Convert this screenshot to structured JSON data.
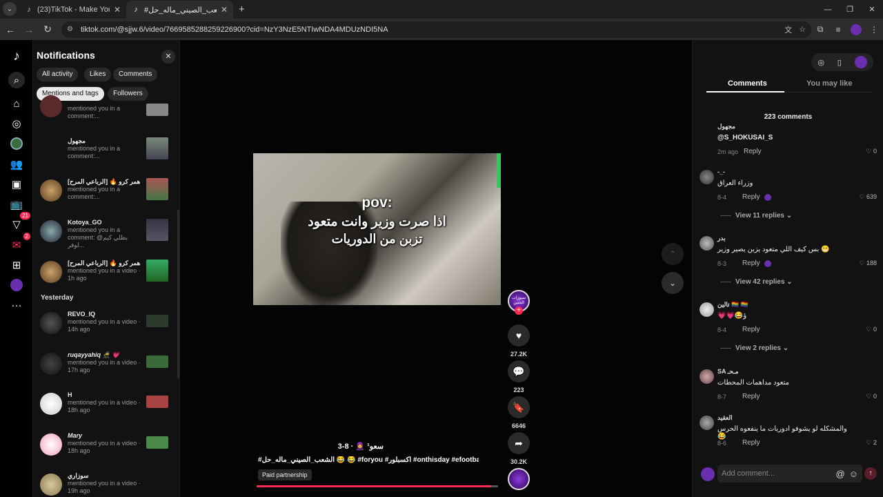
{
  "browser": {
    "tabs": [
      {
        "title": "(23)TikTok - Make Your Day",
        "icon": "tiktok-icon"
      },
      {
        "title": "#الشعب_الصيني_ماله_حل 😂 ...",
        "icon": "tiktok-icon"
      }
    ],
    "url": "tiktok.com/@sjjw.6/video/7669585288259226900?cid=NzY3NzE5NTIwNDA4MDUzNDI5NA"
  },
  "rail": {
    "messages_badge": "2",
    "activity_badge": "21"
  },
  "notifications": {
    "title": "Notifications",
    "chips": [
      "All activity",
      "Likes",
      "Comments",
      "Mentions and tags",
      "Followers"
    ],
    "active_chip": "Mentions and tags",
    "section_yesterday": "Yesterday",
    "items": [
      {
        "name": "",
        "text": "mentioned you in a comment:..."
      },
      {
        "name": "مجهول",
        "text": "mentioned you in a comment:..."
      },
      {
        "name": "[الرباعي المرح] 🔥 همر كرو ...",
        "text": "mentioned you in a comment:..."
      },
      {
        "name": "Kotoya_GO",
        "text": "mentioned you in a comment: @بطلي كيم لوفر..."
      },
      {
        "name": "[الرباعي المرح] 🔥 همر كرو ...",
        "text": "mentioned you in a video · 1h ago"
      },
      {
        "name": "REVO_IQ",
        "text": "mentioned you in a video · 14h ago"
      },
      {
        "name": "ruqayyahiq 🥷 💗",
        "text": "mentioned you in a video · 17h ago"
      },
      {
        "name": "H",
        "text": "mentioned you in a video · 18h ago"
      },
      {
        "name": "Mary",
        "text": "mentioned you in a video · 18h ago"
      },
      {
        "name": "سوزاري",
        "text": "mentioned you in a video · 19h ago"
      }
    ]
  },
  "video": {
    "overlay_line1": "pov:",
    "overlay_line2": "اذا صرت وزير وانت متعود",
    "overlay_line3": "تزبن من الدوريات",
    "author": "سعو¹ 🧕 · 8-3",
    "caption": "#الشعب_الصيني_ماله_حل 😂 😂 #foryou #اكسبلور #onthisday #efootball",
    "paid_label": "Paid partnership",
    "progress": 0.97,
    "creator_avatar_text": "سيوزات الحنين",
    "likes": "27.2K",
    "comments": "223",
    "saves": "6646",
    "shares": "30.2K"
  },
  "comments_panel": {
    "tab_comments": "Comments",
    "tab_you_may_like": "You may like",
    "count": "223 comments",
    "reply_label": "Reply",
    "input_placeholder": "Add comment...",
    "items": [
      {
        "user": "مجهول",
        "text": "@S_HOKUSAI_S",
        "date": "2m ago",
        "likes": "0",
        "view_replies": ""
      },
      {
        "user": "-_-",
        "text": "وزراء العراق",
        "date": "8-4",
        "likes": "639",
        "view_replies": "View 11 replies"
      },
      {
        "user": "بدر",
        "text": "بس كيف اللي متعود يزبن يصير وزير 😁",
        "date": "8-3",
        "likes": "188",
        "view_replies": "View 42 replies"
      },
      {
        "user": "تالين 🏳️‍🌈 🏳️‍🌈",
        "text": "💗💗😂ؤ",
        "date": "8-4",
        "likes": "0",
        "view_replies": "View 2 replies"
      },
      {
        "user": "SA مـحـ",
        "text": "متعود مداهمات المحطات",
        "date": "8-7",
        "likes": "0",
        "view_replies": ""
      },
      {
        "user": "العقيد",
        "text": "والمشكله لو يشوفو ادوريات ما ينفعوه الحرس 😂",
        "date": "8-6",
        "likes": "2",
        "view_replies": ""
      }
    ]
  }
}
